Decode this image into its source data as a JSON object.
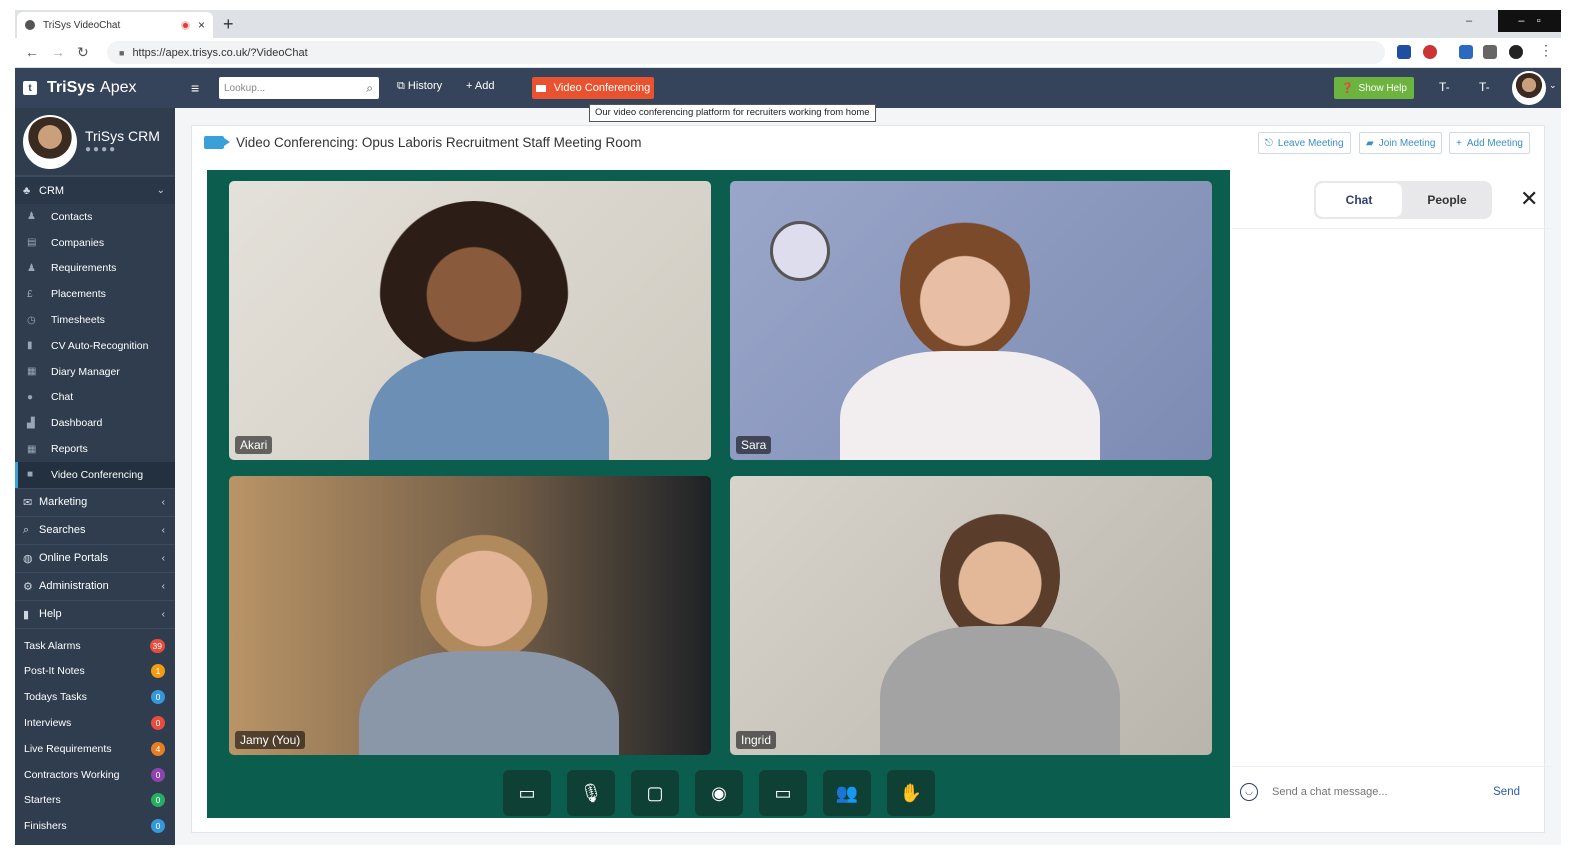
{
  "browser": {
    "tab_title": "TriSys VideoChat",
    "tab_close": "×",
    "new_tab": "+",
    "url": "https://apex.trisys.co.uk/?VideoChat"
  },
  "app": {
    "brand": "TriSys",
    "brand_suffix": "Apex",
    "profile_name": "TriSys CRM"
  },
  "sidebar": {
    "crm_section": "CRM",
    "crm_items": [
      {
        "label": "Contacts",
        "icon": "contacts-icon"
      },
      {
        "label": "Companies",
        "icon": "companies-icon"
      },
      {
        "label": "Requirements",
        "icon": "requirements-icon"
      },
      {
        "label": "Placements",
        "icon": "pound-icon"
      },
      {
        "label": "Timesheets",
        "icon": "stopwatch-icon"
      },
      {
        "label": "CV Auto-Recognition",
        "icon": "document-icon"
      },
      {
        "label": "Diary Manager",
        "icon": "calendar-icon"
      },
      {
        "label": "Chat",
        "icon": "chat-bubble-icon"
      },
      {
        "label": "Dashboard",
        "icon": "bar-chart-icon"
      },
      {
        "label": "Reports",
        "icon": "report-icon"
      },
      {
        "label": "Video Conferencing",
        "icon": "video-camera-icon"
      }
    ],
    "sections": [
      {
        "label": "Marketing",
        "icon": "envelope-icon"
      },
      {
        "label": "Searches",
        "icon": "search-icon"
      },
      {
        "label": "Online Portals",
        "icon": "globe-icon"
      },
      {
        "label": "Administration",
        "icon": "gear-icon"
      },
      {
        "label": "Help",
        "icon": "book-icon"
      }
    ],
    "stats": [
      {
        "label": "Task Alarms",
        "count": "39",
        "color": "#e74c3c"
      },
      {
        "label": "Post-It Notes",
        "count": "1",
        "color": "#f39c12"
      },
      {
        "label": "Todays Tasks",
        "count": "0",
        "color": "#3498db"
      },
      {
        "label": "Interviews",
        "count": "0",
        "color": "#e74c3c"
      },
      {
        "label": "Live Requirements",
        "count": "4",
        "color": "#e67e22"
      },
      {
        "label": "Contractors Working",
        "count": "0",
        "color": "#8e44ad"
      },
      {
        "label": "Starters",
        "count": "0",
        "color": "#27ae60"
      },
      {
        "label": "Finishers",
        "count": "0",
        "color": "#3498db"
      }
    ]
  },
  "topbar": {
    "lookup_placeholder": "Lookup...",
    "history": "History",
    "add": "Add",
    "video_conferencing": "Video Conferencing",
    "tooltip": "Our video conferencing platform for recruiters working from home",
    "show_help": "Show Help",
    "font_smaller": "T-",
    "font_larger": "T-"
  },
  "meeting": {
    "title": "Video Conferencing: Opus Laboris Recruitment Staff Meeting Room",
    "leave": "Leave Meeting",
    "join": "Join Meeting",
    "add": "Add Meeting",
    "participants": [
      "Akari",
      "Sara",
      "Jamy (You)",
      "Ingrid"
    ],
    "controls": [
      "camera-icon",
      "microphone-icon",
      "screen-share-icon",
      "record-icon",
      "chat-icon",
      "participants-icon",
      "raise-hand-icon"
    ]
  },
  "chat_panel": {
    "tab_chat": "Chat",
    "tab_people": "People",
    "placeholder": "Send a chat message...",
    "send": "Send"
  }
}
